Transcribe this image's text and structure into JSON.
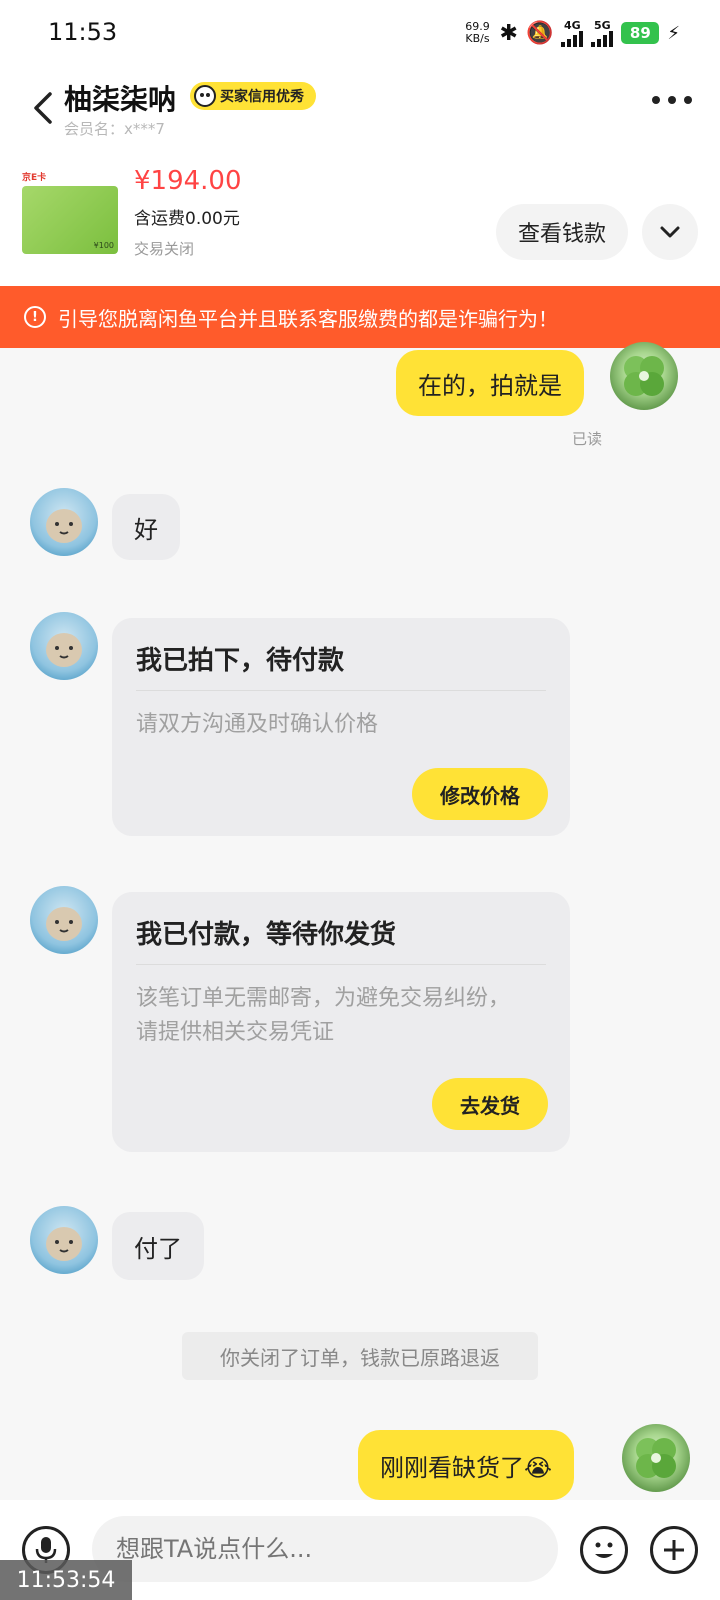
{
  "status_bar": {
    "time": "11:53",
    "speed_value": "69.9",
    "speed_unit": "KB/s",
    "net1": "4G",
    "net2": "5G",
    "battery": "89"
  },
  "header": {
    "name": "柚柒柒呐",
    "credit_badge": "买家信用优秀",
    "member": "会员名：x***7"
  },
  "product": {
    "price": "¥194.00",
    "shipping": "含运费0.00元",
    "status": "交易关闭",
    "view_button": "查看钱款",
    "image_brand": "京E卡",
    "image_value": "¥100"
  },
  "warning": {
    "text": "引导您脱离闲鱼平台并且联系客服缴费的都是诈骗行为！"
  },
  "messages": {
    "m1": "在的，拍就是",
    "m1_read": "已读",
    "m2": "好",
    "card1_title": "我已拍下，待付款",
    "card1_body": "请双方沟通及时确认价格",
    "card1_button": "修改价格",
    "card2_title": "我已付款，等待你发货",
    "card2_body": "该笔订单无需邮寄，为避免交易纠纷，请提供相关交易凭证",
    "card2_button": "去发货",
    "m3": "付了",
    "system_note": "你关闭了订单，钱款已原路退返",
    "m4": "刚刚看缺货了😭"
  },
  "input": {
    "placeholder": "想跟TA说点什么..."
  },
  "overlay_time": "11:53:54",
  "colors": {
    "accent_yellow": "#ffe236",
    "warning_orange": "#ff5b2b",
    "price_red": "#ff4444"
  }
}
